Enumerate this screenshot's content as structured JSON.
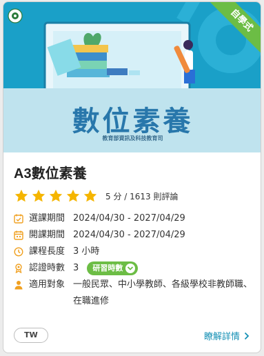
{
  "card": {
    "banner": {
      "title": "數位素養",
      "subtitle": "教育部資訊及科技教育司",
      "ribbon": "自學式",
      "logo_icon": "moe-seal-icon"
    },
    "course_title": "A3數位素養",
    "rating": {
      "stars": 5,
      "max_stars": 5,
      "text": "5 分 / 1613 則評論",
      "star_color": "#f5b500"
    },
    "info": [
      {
        "icon": "calendar-check-icon",
        "label": "選課期間",
        "value": "2024/04/30 - 2027/04/29"
      },
      {
        "icon": "calendar-icon",
        "label": "開課期間",
        "value": "2024/04/30 - 2027/04/29"
      },
      {
        "icon": "clock-icon",
        "label": "課程長度",
        "value": "3 小時"
      },
      {
        "icon": "award-icon",
        "label": "認證時數",
        "value": "3",
        "badge": "研習時數"
      },
      {
        "icon": "user-icon",
        "label": "適用對象",
        "value": "一般民眾、中小學教師、各級學校非教師職、在職進修"
      }
    ],
    "tag": "TW",
    "detail_link": "瞭解詳情",
    "colors": {
      "accent": "#6cbd45",
      "link": "#1590b5",
      "icon": "#f0a020",
      "banner_top": "#1aa0c8",
      "banner_bottom": "#bfe3ee"
    }
  }
}
